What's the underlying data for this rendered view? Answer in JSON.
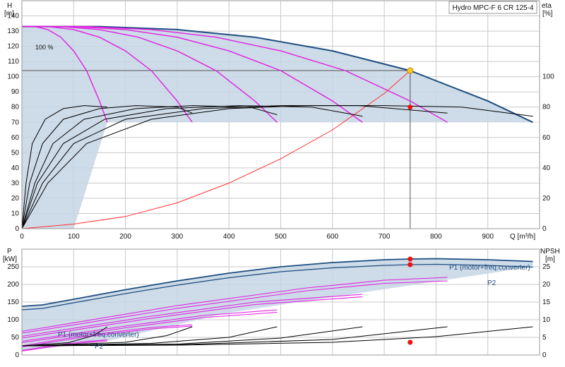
{
  "chart_data": [
    {
      "type": "line",
      "panel": "head-efficiency",
      "title": "Hydro MPC-F 6 CR 125-4",
      "ylabel_left": "H",
      "yunit_left": "[m]",
      "ylabel_right": "eta",
      "yunit_right": "[%]",
      "xlabel": "Q [m³/h]",
      "xlim": [
        0,
        1000
      ],
      "ylim_left": [
        0,
        150
      ],
      "ylim_right": [
        0,
        150
      ],
      "x_ticks": [
        0,
        100,
        200,
        300,
        400,
        500,
        600,
        700,
        800,
        900
      ],
      "y_ticks_left": [
        0,
        10,
        20,
        30,
        40,
        50,
        60,
        70,
        80,
        90,
        100,
        110,
        120,
        130,
        140
      ],
      "y_ticks_right": [
        0,
        20,
        40,
        60,
        80,
        100
      ],
      "speed_label": "100 %",
      "grid": true,
      "colors": {
        "max_curve": "#1f4e80",
        "reduced_speed": "#e020e0",
        "system_curve": "#ff3030",
        "envelope": "#c5d5e4",
        "efficiency": "#000000"
      },
      "head_curves": [
        {
          "units": 6,
          "x": [
            0,
            150,
            300,
            450,
            600,
            750,
            900,
            987
          ],
          "y": [
            133,
            133,
            131,
            126,
            117,
            104,
            84,
            70
          ]
        },
        {
          "units": 5,
          "x": [
            0,
            125,
            250,
            375,
            500,
            625,
            750,
            822
          ],
          "y": [
            133,
            133,
            131,
            126,
            117,
            104,
            84,
            70
          ]
        },
        {
          "units": 4,
          "x": [
            0,
            100,
            200,
            300,
            400,
            500,
            600,
            658
          ],
          "y": [
            133,
            133,
            131,
            126,
            117,
            104,
            84,
            70
          ]
        },
        {
          "units": 3,
          "x": [
            0,
            75,
            150,
            225,
            300,
            375,
            450,
            493
          ],
          "y": [
            133,
            133,
            131,
            126,
            117,
            104,
            84,
            70
          ]
        },
        {
          "units": 2,
          "x": [
            0,
            50,
            100,
            150,
            200,
            250,
            300,
            329
          ],
          "y": [
            133,
            133,
            131,
            126,
            117,
            104,
            84,
            70
          ]
        },
        {
          "units": 1,
          "x": [
            0,
            25,
            50,
            75,
            100,
            125,
            150,
            165
          ],
          "y": [
            133,
            133,
            131,
            126,
            117,
            104,
            84,
            70
          ]
        }
      ],
      "system_curve": {
        "x": [
          0,
          100,
          200,
          300,
          400,
          500,
          600,
          700,
          750
        ],
        "y": [
          0,
          3,
          8,
          17,
          30,
          46,
          65,
          89,
          104
        ]
      },
      "duty_point": {
        "x": 750,
        "y": 104
      },
      "efficiency_curves": [
        {
          "x": [
            0,
            50,
            125,
            250,
            400,
            550,
            700,
            850,
            987
          ],
          "y": [
            0,
            30,
            56,
            72,
            79,
            81,
            81,
            80,
            74
          ]
        },
        {
          "x": [
            0,
            40,
            100,
            200,
            350,
            500,
            650,
            822
          ],
          "y": [
            0,
            30,
            56,
            72,
            79,
            81,
            81,
            76
          ]
        },
        {
          "x": [
            0,
            30,
            80,
            160,
            280,
            420,
            560,
            658
          ],
          "y": [
            0,
            30,
            56,
            72,
            79,
            81,
            80,
            74
          ]
        },
        {
          "x": [
            0,
            25,
            60,
            120,
            220,
            330,
            440,
            493
          ],
          "y": [
            0,
            30,
            56,
            72,
            79,
            81,
            80,
            75
          ]
        },
        {
          "x": [
            0,
            15,
            40,
            80,
            150,
            220,
            300,
            329
          ],
          "y": [
            0,
            30,
            56,
            72,
            79,
            81,
            80,
            76
          ]
        },
        {
          "x": [
            0,
            8,
            20,
            45,
            80,
            120,
            165
          ],
          "y": [
            0,
            30,
            56,
            72,
            79,
            81,
            80
          ]
        }
      ],
      "efficiency_point": {
        "x": 750,
        "y": 80
      }
    },
    {
      "type": "line",
      "panel": "power-npsh",
      "ylabel_left": "P",
      "yunit_left": "[kW]",
      "ylabel_right": "NPSH",
      "yunit_right": "[m]",
      "xlim": [
        0,
        1000
      ],
      "ylim_left": [
        0,
        300
      ],
      "ylim_right": [
        0,
        30
      ],
      "y_ticks_left": [
        0,
        50,
        100,
        150,
        200,
        250
      ],
      "y_ticks_right": [
        0,
        5,
        10,
        15,
        20,
        25
      ],
      "grid": true,
      "series_labels": {
        "p1": "P1 (motor+freq.converter)",
        "p2": "P2"
      },
      "p1_curve": {
        "x": [
          0,
          40,
          100,
          200,
          300,
          400,
          500,
          600,
          700,
          750,
          800,
          900,
          987
        ],
        "y": [
          138,
          142,
          158,
          185,
          210,
          232,
          250,
          262,
          270,
          272,
          273,
          270,
          265
        ]
      },
      "p2_curve": {
        "x": [
          0,
          40,
          100,
          200,
          300,
          400,
          500,
          600,
          700,
          750,
          800,
          900,
          987
        ],
        "y": [
          128,
          132,
          148,
          174,
          198,
          219,
          236,
          247,
          254,
          256,
          257,
          254,
          249
        ]
      },
      "p1_point": {
        "x": 750,
        "y": 272
      },
      "p2_point": {
        "x": 750,
        "y": 256
      },
      "reduced_power_curves": [
        {
          "x": [
            0,
            300,
            550,
            700,
            822
          ],
          "y": [
            67,
            140,
            190,
            212,
            220
          ]
        },
        {
          "x": [
            0,
            300,
            550,
            700,
            822
          ],
          "y": [
            62,
            132,
            182,
            203,
            210
          ]
        },
        {
          "x": [
            0,
            250,
            450,
            658
          ],
          "y": [
            53,
            110,
            150,
            172
          ]
        },
        {
          "x": [
            0,
            250,
            450,
            658
          ],
          "y": [
            48,
            104,
            143,
            165
          ]
        },
        {
          "x": [
            0,
            200,
            350,
            493
          ],
          "y": [
            39,
            82,
            112,
            128
          ]
        },
        {
          "x": [
            0,
            200,
            350,
            493
          ],
          "y": [
            35,
            77,
            106,
            121
          ]
        },
        {
          "x": [
            0,
            120,
            250,
            329
          ],
          "y": [
            26,
            55,
            78,
            86
          ]
        },
        {
          "x": [
            0,
            120,
            250,
            329
          ],
          "y": [
            23,
            51,
            74,
            82
          ]
        },
        {
          "x": [
            0,
            60,
            120,
            165
          ],
          "y": [
            13,
            27,
            38,
            43
          ]
        },
        {
          "x": [
            0,
            60,
            120,
            165
          ],
          "y": [
            11,
            24,
            35,
            40
          ]
        }
      ],
      "npsh_curves": [
        {
          "x": [
            0,
            300,
            600,
            800,
            987
          ],
          "y": [
            2.6,
            2.8,
            3.6,
            5.2,
            8.0
          ]
        },
        {
          "x": [
            0,
            300,
            600,
            822
          ],
          "y": [
            2.6,
            2.9,
            4.4,
            8.0
          ]
        },
        {
          "x": [
            0,
            300,
            500,
            658
          ],
          "y": [
            2.6,
            3.1,
            4.8,
            8.0
          ]
        },
        {
          "x": [
            0,
            250,
            400,
            493
          ],
          "y": [
            2.6,
            3.3,
            5.0,
            8.0
          ]
        },
        {
          "x": [
            0,
            200,
            280,
            329
          ],
          "y": [
            2.6,
            3.6,
            5.5,
            8.0
          ]
        },
        {
          "x": [
            0,
            90,
            140,
            165
          ],
          "y": [
            2.6,
            3.5,
            5.6,
            8.0
          ]
        }
      ],
      "npsh_point": {
        "x": 750,
        "y": 3.6
      }
    }
  ]
}
